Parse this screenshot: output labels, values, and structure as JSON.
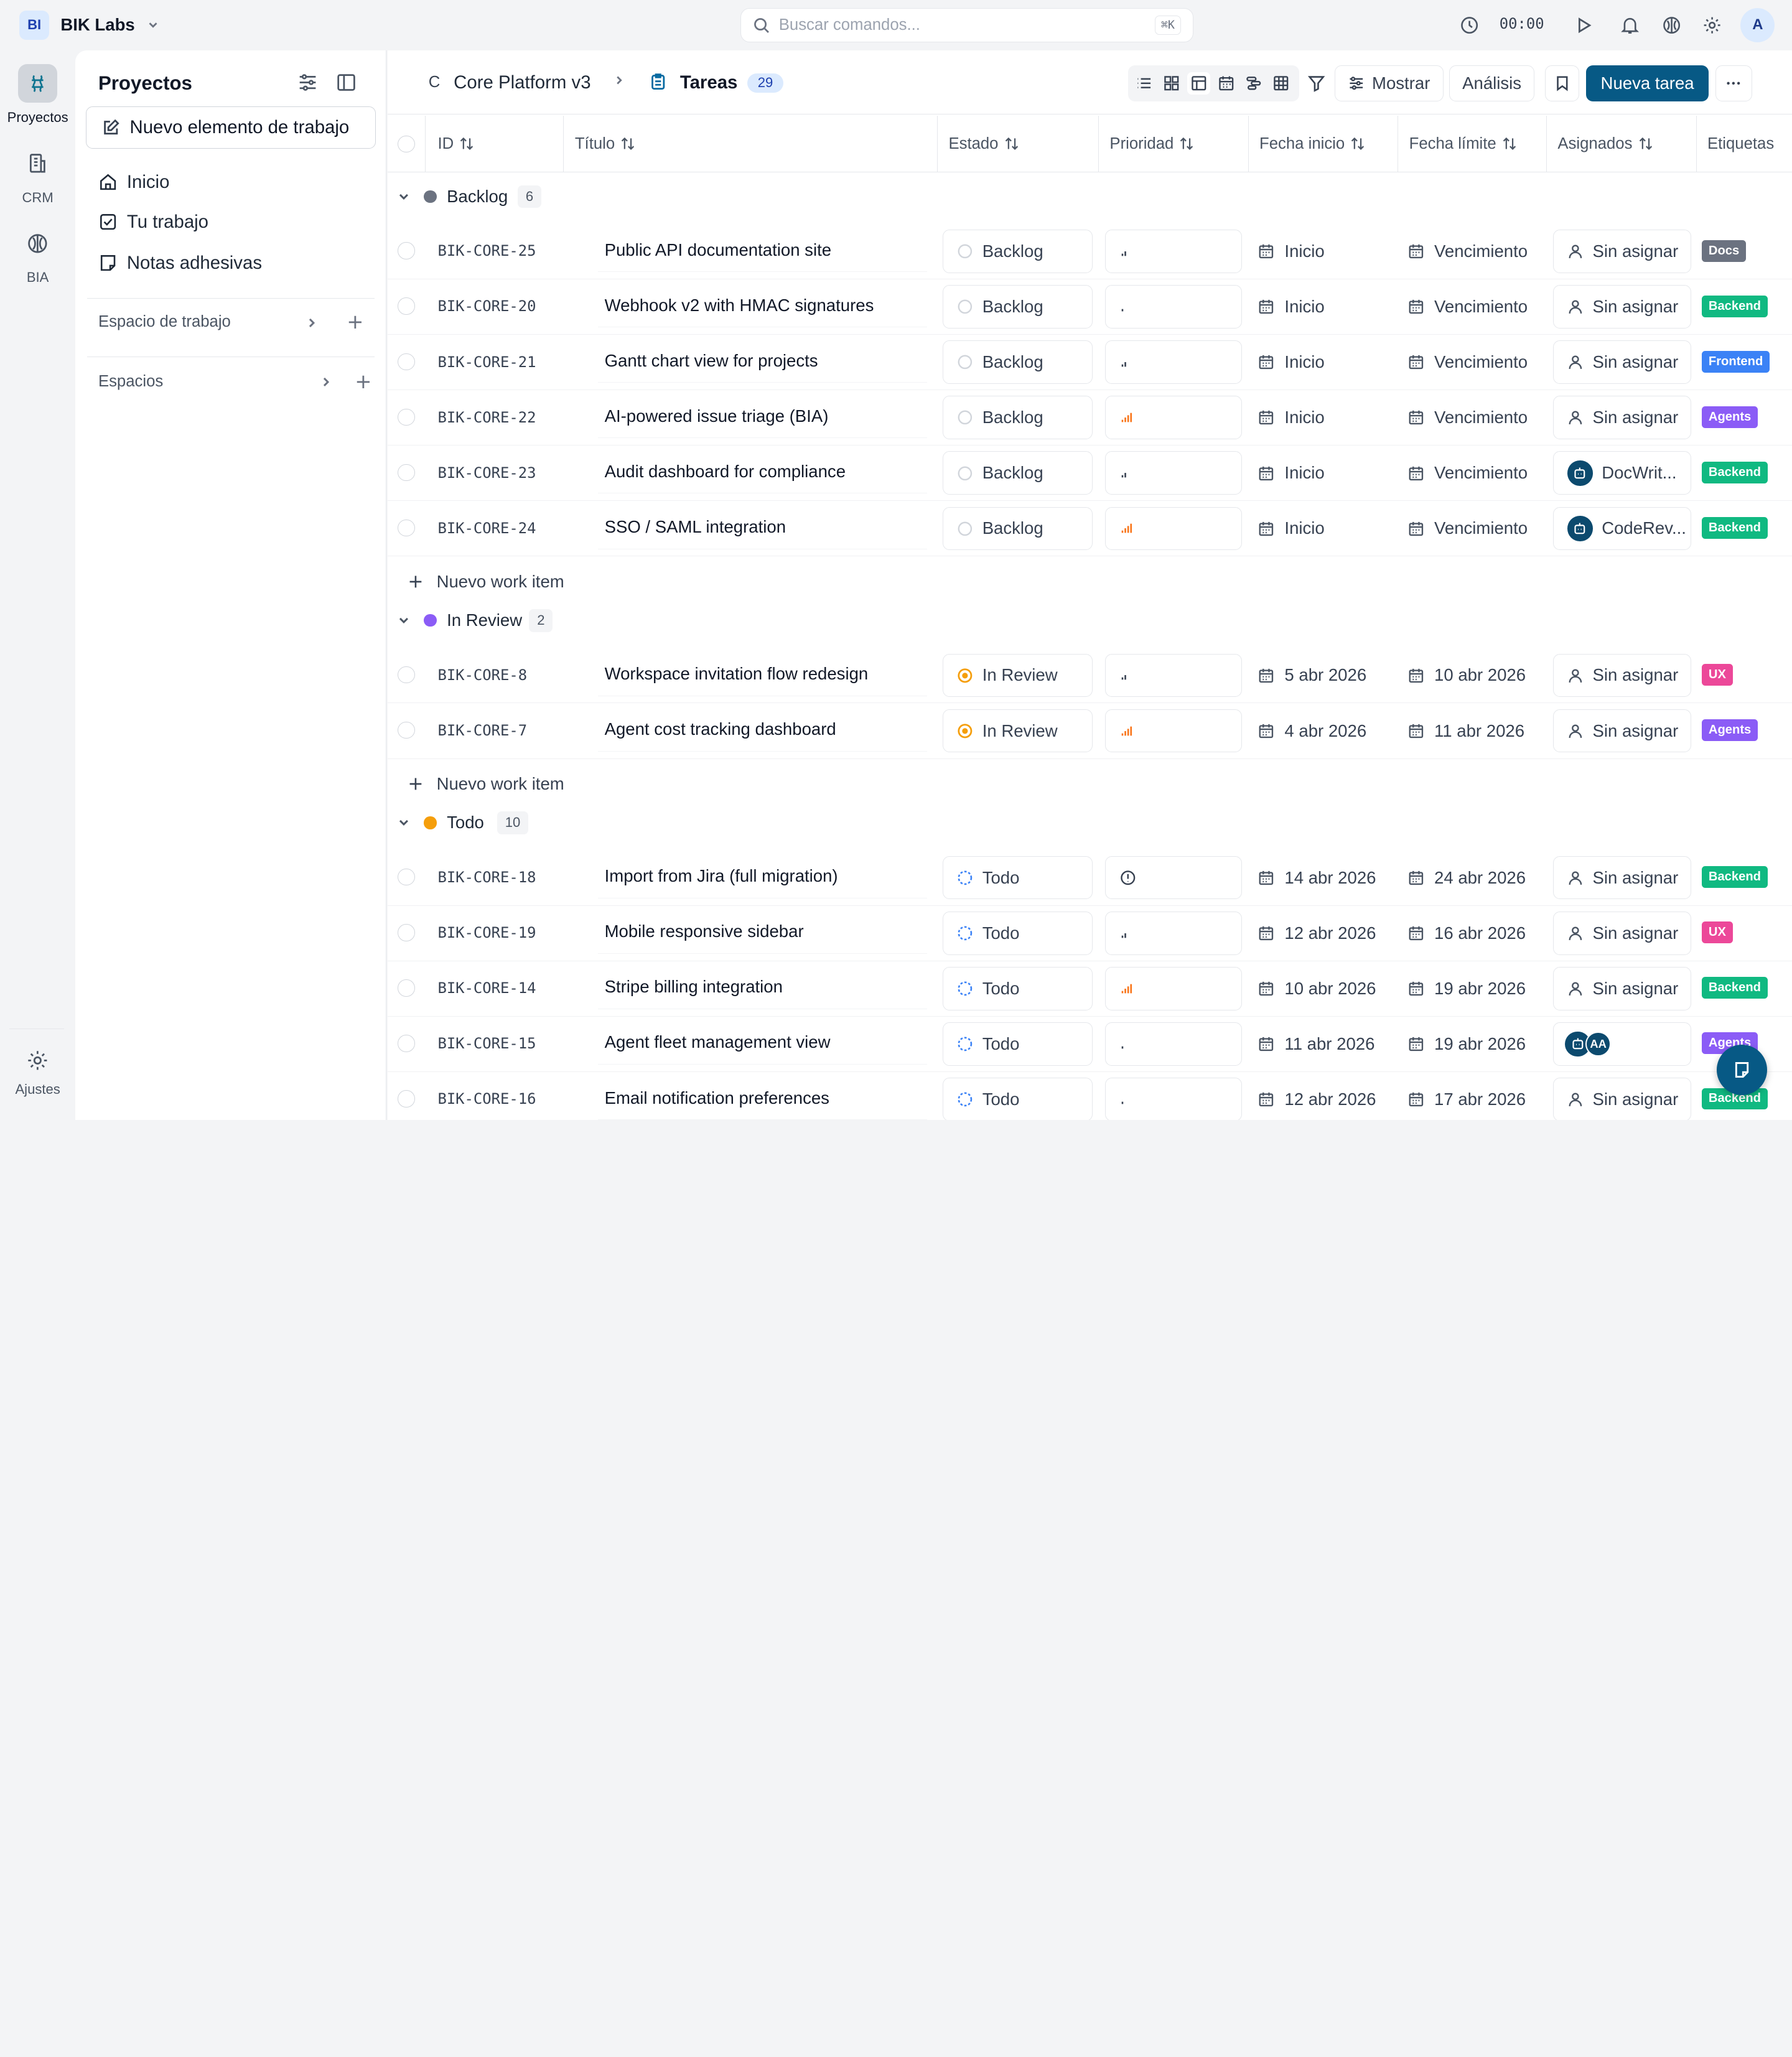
{
  "topbar": {
    "workspace_initials": "BI",
    "workspace_name": "BIK Labs",
    "search_placeholder": "Buscar comandos...",
    "search_shortcut": "⌘K",
    "timer": "00:00",
    "user_initial": "A"
  },
  "rail": {
    "projects": "Proyectos",
    "crm": "CRM",
    "bia": "BIA",
    "settings": "Ajustes"
  },
  "sidebar": {
    "title": "Proyectos",
    "new_item": "Nuevo elemento de trabajo",
    "nav": [
      {
        "label": "Inicio",
        "icon": "home-icon"
      },
      {
        "label": "Tu trabajo",
        "icon": "checkbox-icon"
      },
      {
        "label": "Notas adhesivas",
        "icon": "note-icon"
      }
    ],
    "workspace_section": "Espacio de trabajo",
    "spaces_section": "Espacios"
  },
  "breadcrumb": {
    "project_letter": "C",
    "project": "Core Platform v3",
    "page": "Tareas",
    "count": "29"
  },
  "toolbar": {
    "show_label": "Mostrar",
    "analysis_label": "Análisis",
    "new_task_label": "Nueva tarea"
  },
  "columns": {
    "id": "ID",
    "title": "Título",
    "status": "Estado",
    "priority": "Prioridad",
    "start": "Fecha inicio",
    "due": "Fecha límite",
    "assignees": "Asignados",
    "labels": "Etiquetas"
  },
  "add_row_label": "Nuevo work item",
  "colors": {
    "primary": "#075985",
    "backlog_dot": "#6b7280",
    "review_dot": "#8b5cf6",
    "todo_dot": "#f59e0b",
    "label_docs": "#6b7280",
    "label_backend": "#10b981",
    "label_frontend": "#3b82f6",
    "label_agents": "#8b5cf6",
    "label_ux": "#ec4899"
  },
  "groups": [
    {
      "name": "Backlog",
      "count": "6",
      "rows": [
        {
          "id": "BIK-CORE-25",
          "title": "Public API documentation site",
          "status": "Backlog",
          "priority": "low",
          "start": "Inicio",
          "due": "Vencimiento",
          "assignee": "Sin asignar",
          "label": "Docs"
        },
        {
          "id": "BIK-CORE-20",
          "title": "Webhook v2 with HMAC signatures",
          "status": "Backlog",
          "priority": "none",
          "start": "Inicio",
          "due": "Vencimiento",
          "assignee": "Sin asignar",
          "label": "Backend"
        },
        {
          "id": "BIK-CORE-21",
          "title": "Gantt chart view for projects",
          "status": "Backlog",
          "priority": "low",
          "start": "Inicio",
          "due": "Vencimiento",
          "assignee": "Sin asignar",
          "label": "Frontend"
        },
        {
          "id": "BIK-CORE-22",
          "title": "AI-powered issue triage (BIA)",
          "status": "Backlog",
          "priority": "high",
          "start": "Inicio",
          "due": "Vencimiento",
          "assignee": "Sin asignar",
          "label": "Agents"
        },
        {
          "id": "BIK-CORE-23",
          "title": "Audit dashboard for compliance",
          "status": "Backlog",
          "priority": "low",
          "start": "Inicio",
          "due": "Vencimiento",
          "assignee": "DocWrit...",
          "label": "Backend"
        },
        {
          "id": "BIK-CORE-24",
          "title": "SSO / SAML integration",
          "status": "Backlog",
          "priority": "high",
          "start": "Inicio",
          "due": "Vencimiento",
          "assignee": "CodeRev...",
          "label": "Backend"
        }
      ]
    },
    {
      "name": "In Review",
      "count": "2",
      "rows": [
        {
          "id": "BIK-CORE-8",
          "title": "Workspace invitation flow redesign",
          "status": "In Review",
          "priority": "low",
          "start": "5 abr 2026",
          "due": "10 abr 2026",
          "assignee": "Sin asignar",
          "label": "UX"
        },
        {
          "id": "BIK-CORE-7",
          "title": "Agent cost tracking dashboard",
          "status": "In Review",
          "priority": "high",
          "start": "4 abr 2026",
          "due": "11 abr 2026",
          "assignee": "Sin asignar",
          "label": "Agents"
        }
      ]
    },
    {
      "name": "Todo",
      "count": "10",
      "rows": [
        {
          "id": "BIK-CORE-18",
          "title": "Import from Jira (full migration)",
          "status": "Todo",
          "priority": "urgent",
          "start": "14 abr 2026",
          "due": "24 abr 2026",
          "assignee": "Sin asignar",
          "label": "Backend"
        },
        {
          "id": "BIK-CORE-19",
          "title": "Mobile responsive sidebar",
          "status": "Todo",
          "priority": "low",
          "start": "12 abr 2026",
          "due": "16 abr 2026",
          "assignee": "Sin asignar",
          "label": "UX"
        },
        {
          "id": "BIK-CORE-14",
          "title": "Stripe billing integration",
          "status": "Todo",
          "priority": "high",
          "start": "10 abr 2026",
          "due": "19 abr 2026",
          "assignee": "Sin asignar",
          "label": "Backend"
        },
        {
          "id": "BIK-CORE-15",
          "title": "Agent fleet management view",
          "status": "Todo",
          "priority": "none",
          "start": "11 abr 2026",
          "due": "19 abr 2026",
          "assignee": "",
          "assignee_initials": "AA",
          "label": "Agents"
        },
        {
          "id": "BIK-CORE-16",
          "title": "Email notification preferences",
          "status": "Todo",
          "priority": "none",
          "start": "12 abr 2026",
          "due": "17 abr 2026",
          "assignee": "Sin asignar",
          "label": "Backend"
        }
      ]
    }
  ]
}
